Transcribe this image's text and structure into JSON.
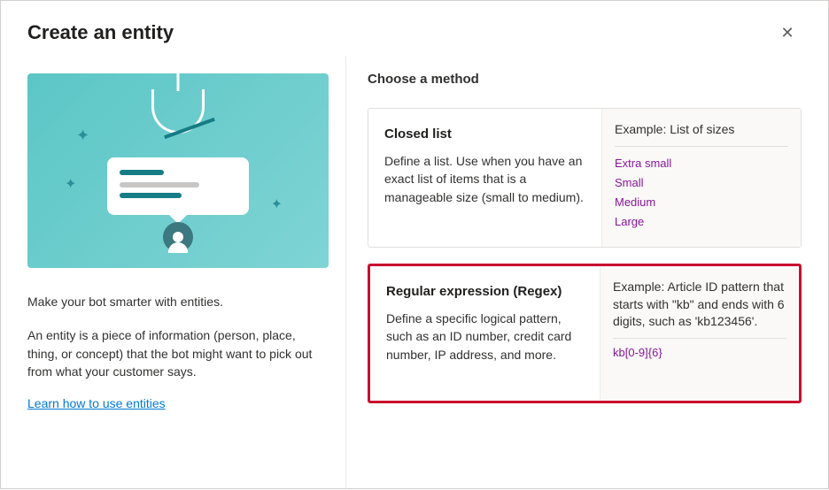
{
  "header": {
    "title": "Create an entity"
  },
  "left": {
    "intro": "Make your bot smarter with entities.",
    "description": "An entity is a piece of information (person, place, thing, or concept) that the bot might want to pick out from what your customer says.",
    "link": "Learn how to use entities"
  },
  "right": {
    "title": "Choose a method",
    "methods": [
      {
        "title": "Closed list",
        "description": "Define a list. Use when you have an exact list of items that is a manageable size (small to medium).",
        "example_label": "Example: List of sizes",
        "items": [
          "Extra small",
          "Small",
          "Medium",
          "Large"
        ]
      },
      {
        "title": "Regular expression (Regex)",
        "description": "Define a specific logical pattern, such as an ID number, credit card number, IP address, and more.",
        "example_label": "Example: Article ID pattern that starts with \"kb\" and ends with 6 digits, such as 'kb123456'.",
        "pattern": "kb[0-9]{6}"
      }
    ]
  }
}
